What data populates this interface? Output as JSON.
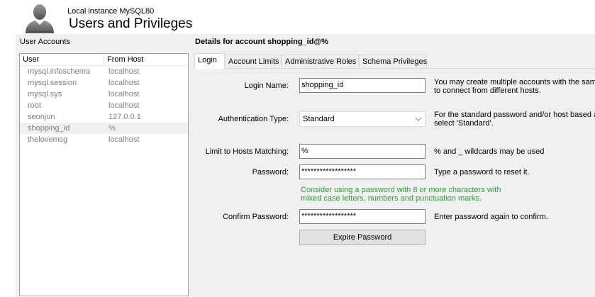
{
  "header": {
    "instance_label": "Local instance MySQL80",
    "title": "Users and Privileges"
  },
  "accounts": {
    "label": "User Accounts",
    "columns": {
      "user": "User",
      "host": "From Host"
    },
    "rows": [
      {
        "user": "mysql.infoschema",
        "host": "localhost"
      },
      {
        "user": "mysql.session",
        "host": "localhost"
      },
      {
        "user": "mysql.sys",
        "host": "localhost"
      },
      {
        "user": "root",
        "host": "localhost"
      },
      {
        "user": "seonjun",
        "host": "127.0.0.1"
      },
      {
        "user": "shopping_id",
        "host": "%"
      },
      {
        "user": "thelovemsg",
        "host": "localhost"
      }
    ],
    "selected_index": 5
  },
  "details": {
    "title": "Details for account shopping_id@%",
    "tabs": [
      "Login",
      "Account Limits",
      "Administrative Roles",
      "Schema Privileges"
    ],
    "active_tab": "Login",
    "login_name": {
      "label": "Login Name:",
      "value": "shopping_id",
      "help": [
        "You may create multiple accounts with the same",
        "to connect from different hosts."
      ]
    },
    "auth_type": {
      "label": "Authentication Type:",
      "value": "Standard",
      "help": [
        "For the standard password and/or host based au",
        "select 'Standard'."
      ]
    },
    "hosts": {
      "label": "Limit to Hosts Matching:",
      "value": "%",
      "help": "% and _ wildcards may be used"
    },
    "password": {
      "label": "Password:",
      "value": "******************",
      "help": "Type a password to reset it."
    },
    "password_hint": [
      "Consider using a password with 8 or more characters with",
      "mixed case letters, numbers and punctuation marks."
    ],
    "confirm": {
      "label": "Confirm Password:",
      "value": "******************",
      "help": "Enter password again to confirm."
    },
    "expire_button": "Expire Password"
  },
  "colors": {
    "hint": "#2a9d38",
    "muted_text": "#808080",
    "panel_bg": "#f0f0f0"
  }
}
